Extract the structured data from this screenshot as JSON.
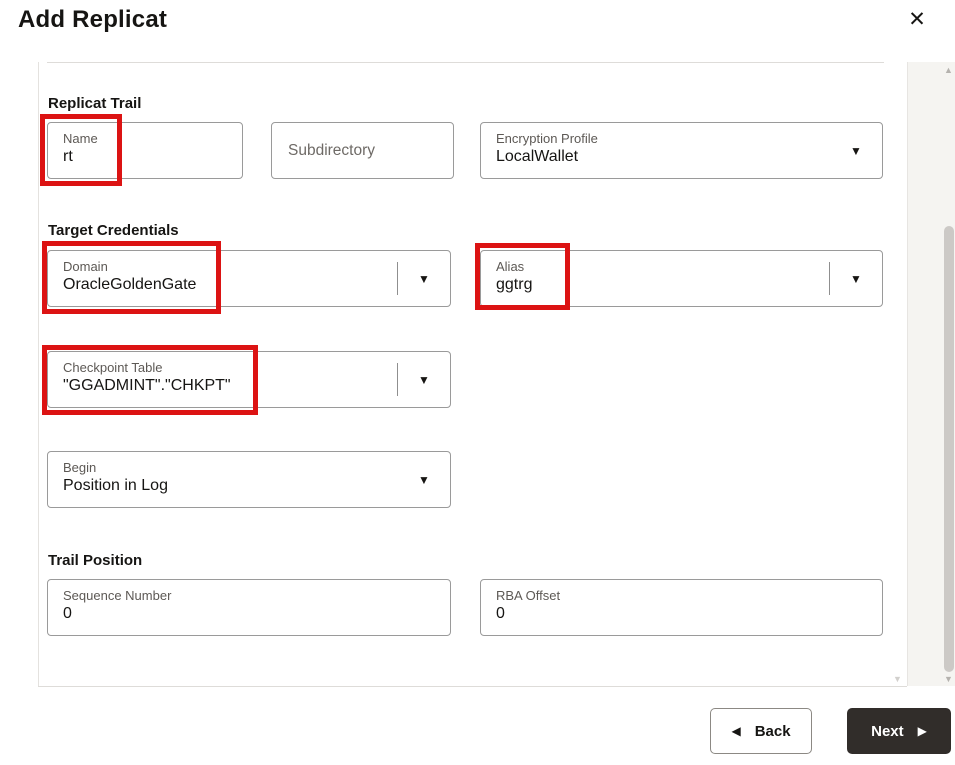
{
  "dialog": {
    "title": "Add Replicat"
  },
  "icons": {
    "close": "✕",
    "dropdown_arrow": "▼",
    "back_arrow": "◀",
    "next_arrow": "▶",
    "scroll_up": "▲",
    "scroll_down": "▼"
  },
  "sections": {
    "replicat_trail": {
      "label": "Replicat Trail",
      "fields": {
        "name": {
          "label": "Name",
          "value": "rt"
        },
        "subdirectory": {
          "placeholder": "Subdirectory"
        },
        "encryption_profile": {
          "label": "Encryption Profile",
          "value": "LocalWallet"
        }
      }
    },
    "target_credentials": {
      "label": "Target Credentials",
      "fields": {
        "domain": {
          "label": "Domain",
          "value": "OracleGoldenGate"
        },
        "alias": {
          "label": "Alias",
          "value": "ggtrg"
        },
        "checkpoint_table": {
          "label": "Checkpoint Table",
          "value": "\"GGADMINT\".\"CHKPT\""
        },
        "begin": {
          "label": "Begin",
          "value": "Position in Log"
        }
      }
    },
    "trail_position": {
      "label": "Trail Position",
      "fields": {
        "sequence_number": {
          "label": "Sequence Number",
          "value": "0"
        },
        "rba_offset": {
          "label": "RBA Offset",
          "value": "0"
        }
      }
    }
  },
  "footer": {
    "back_label": "Back",
    "next_label": "Next"
  },
  "colors": {
    "highlight_red": "#dc1313",
    "next_button_bg": "#312d2a"
  }
}
